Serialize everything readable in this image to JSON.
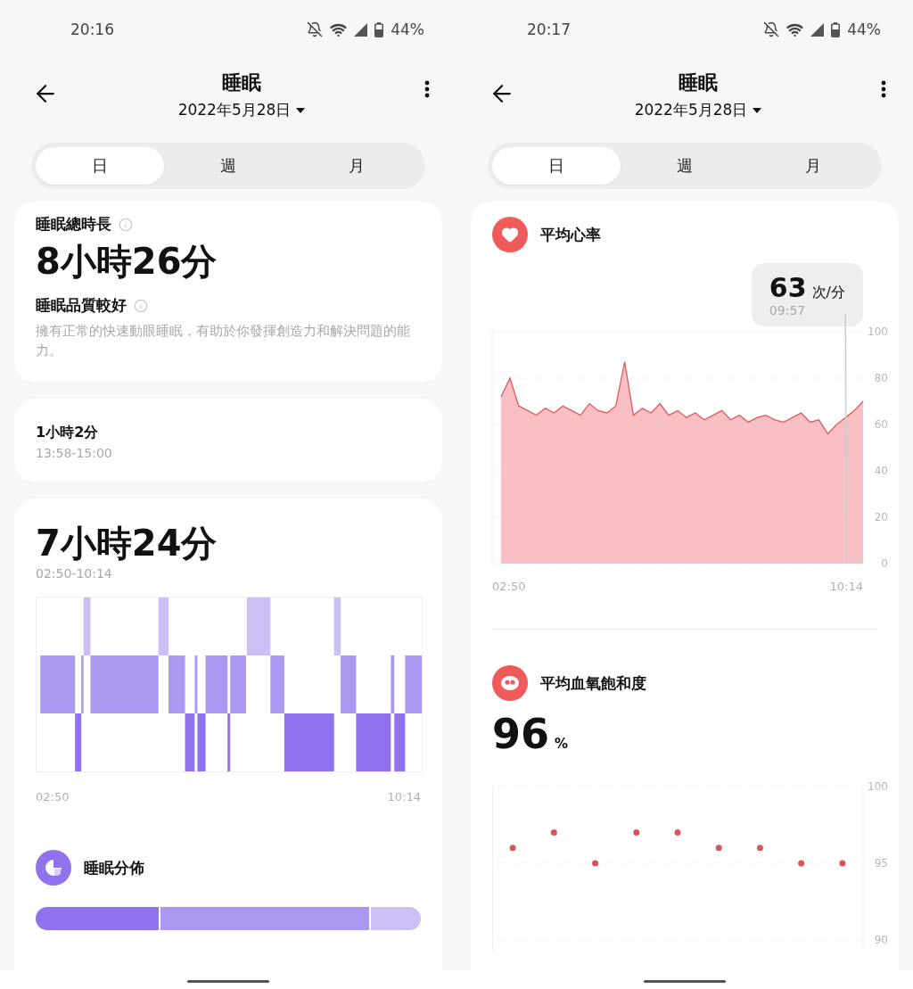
{
  "screens": [
    {
      "status_bar": {
        "time": "20:16",
        "battery": "44%"
      },
      "header": {
        "title": "睡眠",
        "date": "2022年5月28日"
      },
      "tabs": [
        {
          "label": "日",
          "selected": true
        },
        {
          "label": "週",
          "selected": false
        },
        {
          "label": "月",
          "selected": false
        }
      ],
      "cards": [
        {
          "kind": "summary",
          "label": "睡眠總時長",
          "value": "8小時26分",
          "quality": "睡眠品質較好",
          "description": "擁有正常的快速動眼睡眠，有助於你發揮創造力和解決問題的能力。"
        },
        {
          "kind": "nap",
          "duration": "1小時2分",
          "range": "13:58-15:00"
        },
        {
          "kind": "session",
          "duration": "7小時24分",
          "range": "02:50-10:14",
          "start": "02:50",
          "end": "10:14",
          "distribution": {
            "title": "睡眠分佈",
            "segments": [
              {
                "color": "#9073ec"
              },
              {
                "color": "#ab98f0"
              },
              {
                "color": "#cbbff5"
              }
            ]
          }
        }
      ]
    },
    {
      "status_bar": {
        "time": "20:17",
        "battery": "44%"
      },
      "header": {
        "title": "睡眠",
        "date": "2022年5月28日"
      },
      "tabs": [
        {
          "label": "日",
          "selected": true
        },
        {
          "label": "週",
          "selected": false
        },
        {
          "label": "月",
          "selected": false
        }
      ],
      "cards": [
        {
          "kind": "vitals",
          "sections": [
            {
              "kind": "heart_rate",
              "title": "平均心率",
              "tooltip": {
                "value": "63",
                "unit": "次/分",
                "time": "09:57"
              },
              "start": "02:50",
              "end": "10:14",
              "chart_data": {
                "type": "area",
                "grid": true,
                "ylim": [
                  0,
                  100
                ],
                "yticks": [
                  0,
                  20,
                  40,
                  60,
                  80,
                  100
                ],
                "series": [
                  {
                    "color": "#e05a5a",
                    "values": [
                      72,
                      80,
                      68,
                      66,
                      64,
                      67,
                      65,
                      68,
                      66,
                      64,
                      69,
                      66,
                      65,
                      68,
                      87,
                      64,
                      67,
                      65,
                      69,
                      64,
                      66,
                      63,
                      65,
                      62,
                      64,
                      66,
                      62,
                      64,
                      61,
                      63,
                      64,
                      62,
                      61,
                      63,
                      65,
                      61,
                      62,
                      56,
                      60,
                      63,
                      66,
                      70
                    ]
                  }
                ]
              }
            },
            {
              "kind": "spo2",
              "title": "平均血氧飽和度",
              "value": "96",
              "unit": "%",
              "chart_data": {
                "type": "scatter",
                "grid": true,
                "ylim": [
                  90,
                  100
                ],
                "yticks": [
                  90,
                  95,
                  100
                ],
                "series": [
                  {
                    "color": "#d95555",
                    "values": [
                      96,
                      97,
                      95,
                      97,
                      97,
                      96,
                      96,
                      95,
                      95
                    ]
                  }
                ]
              }
            }
          ]
        }
      ]
    }
  ]
}
